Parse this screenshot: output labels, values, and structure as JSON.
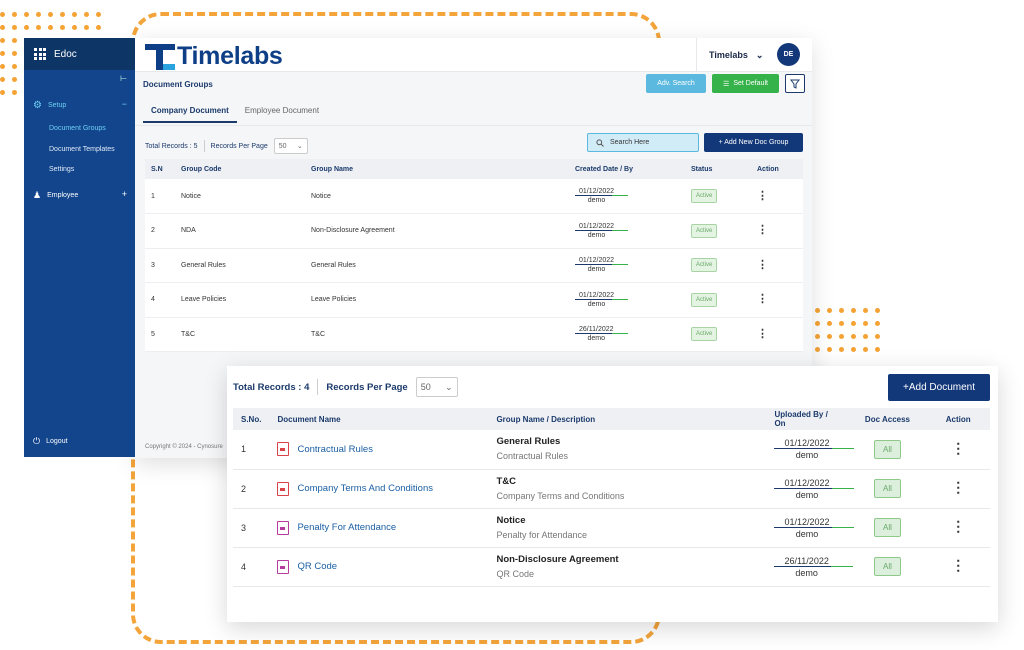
{
  "sidebar": {
    "app_name": "Edoc",
    "setup_label": "Setup",
    "sub_items": [
      "Document Groups",
      "Document Templates",
      "Settings"
    ],
    "employee_label": "Employee",
    "logout_label": "Logout"
  },
  "header": {
    "logo_text": "Timelabs",
    "org_name": "Timelabs",
    "avatar_initials": "DE"
  },
  "page": {
    "title": "Document Groups",
    "adv_search_label": "Adv. Search",
    "set_default_label": "Set Default",
    "tabs": [
      "Company Document",
      "Employee Document"
    ],
    "total_records": "Total Records : 5",
    "records_per_page_label": "Records Per Page",
    "records_per_page_value": "50",
    "search_placeholder": "Search Here",
    "add_button": "+ Add New Doc Group",
    "columns": [
      "S.N",
      "Group Code",
      "Group Name",
      "Created Date / By",
      "Status",
      "Action"
    ],
    "rows": [
      {
        "sn": "1",
        "code": "Notice",
        "name": "Notice",
        "date": "01/12/2022",
        "by": "demo",
        "status": "Active"
      },
      {
        "sn": "2",
        "code": "NDA",
        "name": "Non-Disclosure Agreement",
        "date": "01/12/2022",
        "by": "demo",
        "status": "Active"
      },
      {
        "sn": "3",
        "code": "General Rules",
        "name": "General Rules",
        "date": "01/12/2022",
        "by": "demo",
        "status": "Active"
      },
      {
        "sn": "4",
        "code": "Leave Policies",
        "name": "Leave Policies",
        "date": "01/12/2022",
        "by": "demo",
        "status": "Active"
      },
      {
        "sn": "5",
        "code": "T&C",
        "name": "T&C",
        "date": "26/11/2022",
        "by": "demo",
        "status": "Active"
      }
    ],
    "footer": "Copyright © 2024 - Cynosure"
  },
  "docs": {
    "total_records": "Total Records : 4",
    "records_per_page_label": "Records Per Page",
    "records_per_page_value": "50",
    "add_button": "+Add Document",
    "columns": [
      "S.No.",
      "Document Name",
      "Group Name / Description",
      "Uploaded By / On",
      "Doc Access",
      "Action"
    ],
    "rows": [
      {
        "sn": "1",
        "doc": "Contractual Rules",
        "icon": "pdf-file-icon",
        "group": "General Rules",
        "desc": "Contractual Rules",
        "date": "01/12/2022",
        "by": "demo",
        "access": "All"
      },
      {
        "sn": "2",
        "doc": "Company Terms And Conditions",
        "icon": "pdf-file-icon",
        "group": "T&C",
        "desc": "Company Terms and Conditions",
        "date": "01/12/2022",
        "by": "demo",
        "access": "All"
      },
      {
        "sn": "3",
        "doc": "Penalty For Attendance",
        "icon": "image-file-icon",
        "group": "Notice",
        "desc": "Penalty for Attendance",
        "date": "01/12/2022",
        "by": "demo",
        "access": "All"
      },
      {
        "sn": "4",
        "doc": "QR Code",
        "icon": "image-file-icon",
        "group": "Non-Disclosure Agreement",
        "desc": "QR Code",
        "date": "26/11/2022",
        "by": "demo",
        "access": "All"
      }
    ]
  },
  "colors": {
    "brand": "#12387a",
    "accent": "#29a3de",
    "success": "#36b24a",
    "decor": "#f3a43b"
  }
}
